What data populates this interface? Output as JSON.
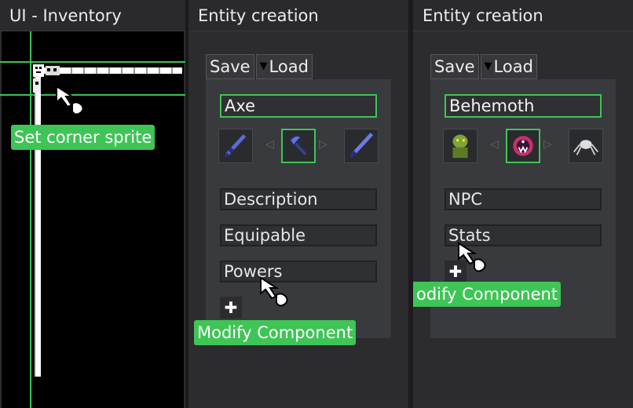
{
  "inventory": {
    "title": "UI - Inventory",
    "tooltip": "Set corner sprite"
  },
  "entity_axe": {
    "title": "Entity creation",
    "save_label": "Save",
    "load_label": "Load",
    "name_value": "Axe",
    "components": [
      "Description",
      "Equipable",
      "Powers"
    ],
    "add_icon": "plus-icon",
    "tooltip": "Modify Component",
    "sprites": [
      "sword-icon",
      "axe-icon",
      "blade-icon"
    ]
  },
  "entity_behemoth": {
    "title": "Entity creation",
    "save_label": "Save",
    "load_label": "Load",
    "name_value": "Behemoth",
    "components": [
      "NPC",
      "Stats"
    ],
    "add_icon": "plus-icon",
    "tooltip": "odify Component",
    "sprites": [
      "goblin-icon",
      "behemoth-icon",
      "spider-icon"
    ]
  },
  "colors": {
    "accent": "#3fc456",
    "panel_bg": "#2c2c2f",
    "field_bg": "#2f3034"
  }
}
